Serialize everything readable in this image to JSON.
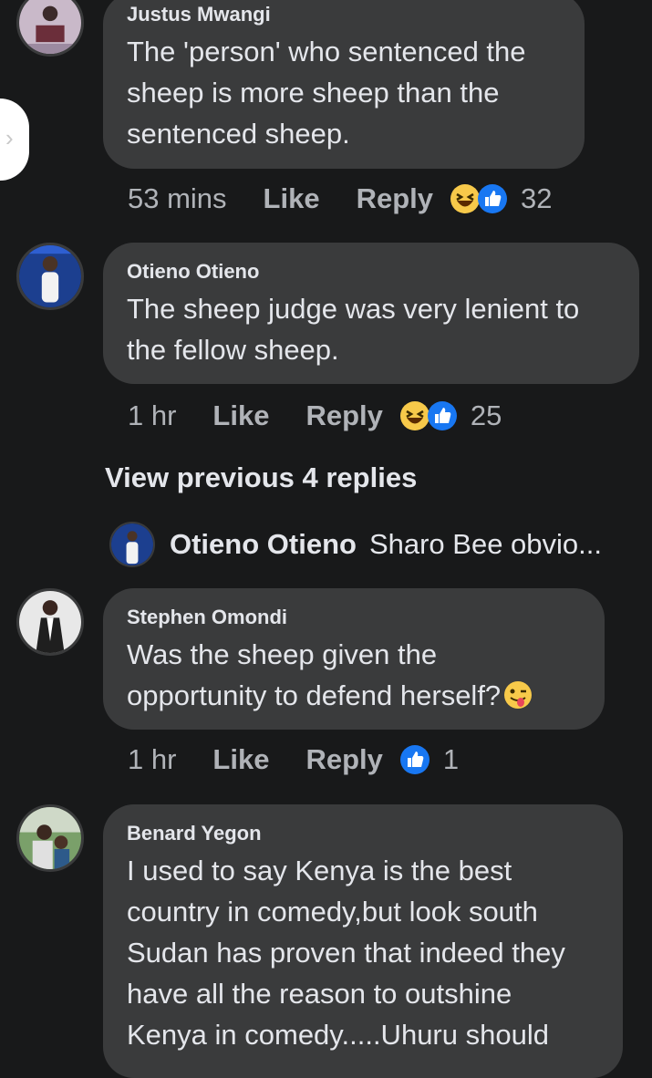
{
  "comments": [
    {
      "author": "Justus Mwangi",
      "text": "The 'person' who sentenced the sheep is more sheep than the sentenced sheep.",
      "time": "53 mins",
      "like": "Like",
      "reply": "Reply",
      "reactions": [
        "haha-icon",
        "like-icon"
      ],
      "count": "32"
    },
    {
      "author": "Otieno Otieno",
      "text": "The sheep judge was very lenient to the fellow sheep.",
      "time": "1 hr",
      "like": "Like",
      "reply": "Reply",
      "reactions": [
        "haha-icon",
        "like-icon"
      ],
      "count": "25"
    },
    {
      "author": "Stephen Omondi",
      "text": "Was the sheep given the opportunity to defend herself?",
      "time": "1 hr",
      "like": "Like",
      "reply": "Reply",
      "reactions": [
        "like-icon"
      ],
      "count": "1"
    },
    {
      "author": "Benard Yegon",
      "text": "I used to say Kenya is the best country in comedy,but look south Sudan has proven that indeed they have all the reason to outshine Kenya in comedy.....Uhuru should"
    }
  ],
  "view_previous": "View previous 4 replies",
  "reply_preview": {
    "name": "Otieno Otieno",
    "text": "Sharo Bee obvio..."
  },
  "colors": {
    "background": "#18191a",
    "bubble": "#3a3b3c",
    "text": "#e4e6eb",
    "secondary": "#b0b3b8",
    "like_blue": "#1877f2",
    "haha_yellow": "#f7c94a"
  }
}
